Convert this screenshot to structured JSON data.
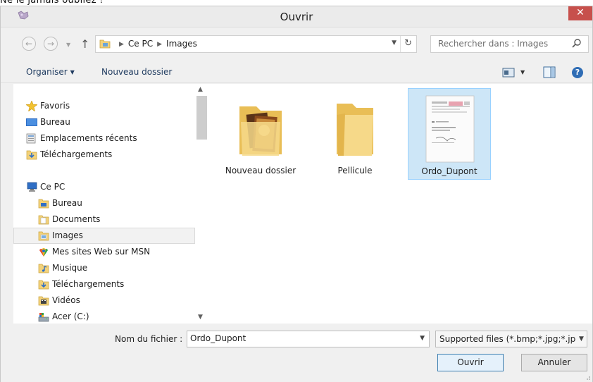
{
  "top_cut_text": "Ne le jamais oubliez !",
  "window": {
    "title": "Ouvrir",
    "close_glyph": "✕"
  },
  "nav": {
    "back_glyph": "←",
    "forward_glyph": "→",
    "up_glyph": "↑",
    "refresh_glyph": "↻"
  },
  "address": {
    "crumbs": [
      "Ce PC",
      "Images"
    ]
  },
  "search": {
    "placeholder": "Rechercher dans : Images"
  },
  "toolbar": {
    "organize_label": "Organiser",
    "new_folder_label": "Nouveau dossier"
  },
  "sidebar": {
    "items": [
      {
        "label": "Favoris",
        "icon": "star-icon"
      },
      {
        "label": "Bureau",
        "icon": "desktop-icon"
      },
      {
        "label": "Emplacements récents",
        "icon": "recent-places-icon"
      },
      {
        "label": "Téléchargements",
        "icon": "downloads-icon"
      },
      {
        "label": "Ce PC",
        "icon": "computer-icon"
      },
      {
        "label": "Bureau",
        "icon": "desktop-folder-icon"
      },
      {
        "label": "Documents",
        "icon": "documents-icon"
      },
      {
        "label": "Images",
        "icon": "pictures-icon"
      },
      {
        "label": "Mes sites Web sur MSN",
        "icon": "msn-icon"
      },
      {
        "label": "Musique",
        "icon": "music-icon"
      },
      {
        "label": "Téléchargements",
        "icon": "downloads-icon"
      },
      {
        "label": "Vidéos",
        "icon": "videos-icon"
      },
      {
        "label": "Acer (C:)",
        "icon": "drive-icon"
      }
    ],
    "selected_label": "Images"
  },
  "files": [
    {
      "name": "Nouveau dossier",
      "type": "folder-with-photos",
      "icon": "folder-photos-icon"
    },
    {
      "name": "Pellicule",
      "type": "folder",
      "icon": "folder-icon"
    },
    {
      "name": "Ordo_Dupont",
      "type": "document",
      "icon": "document-thumbnail-icon",
      "selected": true
    }
  ],
  "bottom": {
    "filename_label": "Nom du fichier :",
    "filename_value": "Ordo_Dupont",
    "filter_label": "Supported files (*.bmp;*.jpg;*.jpeg;*.png)",
    "open_label": "Ouvrir",
    "cancel_label": "Annuler"
  },
  "colors": {
    "close_red": "#c7504c",
    "selection_blue": "#cde6f7",
    "selection_border": "#99d1ff",
    "folder_yellow": "#f3d27a",
    "link_text": "#1e3a5f"
  }
}
